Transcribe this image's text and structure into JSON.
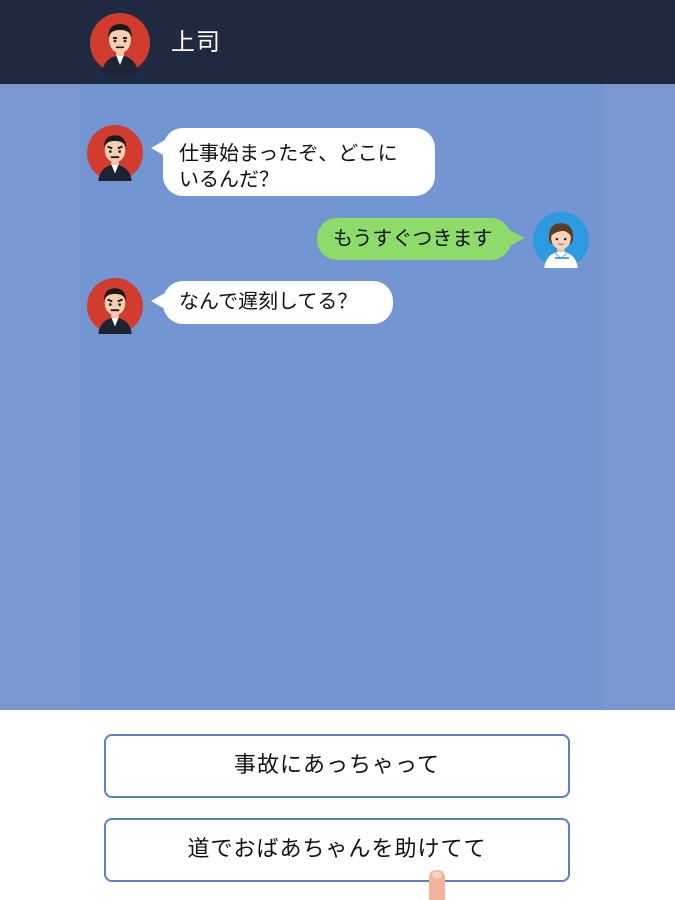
{
  "header": {
    "title": "上司",
    "avatar_icon": "boss-avatar-icon"
  },
  "chat": {
    "messages": [
      {
        "sender": "上司",
        "text_line1": "仕事始まったぞ、どこに",
        "text_line2": "いるんだ？"
      },
      {
        "sender": "me",
        "text": "もうすぐつきます"
      },
      {
        "sender": "上司",
        "text": "なんで遅刻してる？"
      }
    ]
  },
  "replies": {
    "option1": "事故にあっちゃって",
    "option2": "道でおばあちゃんを助けてて"
  },
  "colors": {
    "header_bg": "#1f2a40",
    "chat_bg": "#7396d2",
    "bubble_incoming": "#ffffff",
    "bubble_outgoing": "#8ddb69",
    "button_border": "#5b80c8"
  }
}
